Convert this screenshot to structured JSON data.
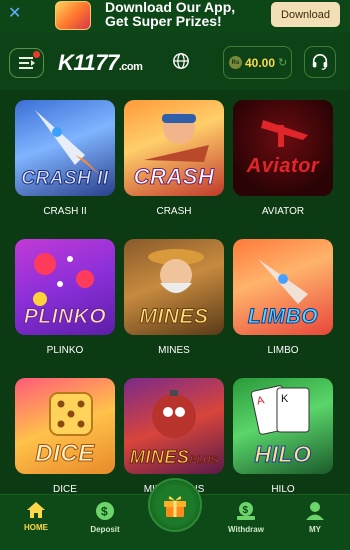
{
  "banner": {
    "line1": "Download Our App,",
    "line2": "Get Super Prizes!",
    "download_label": "Download"
  },
  "header": {
    "logo_main": "K1177",
    "logo_sub": ".com",
    "currency_badge": "Rs",
    "balance": "40.00"
  },
  "games": [
    {
      "label": "CRASH II",
      "art_title": "CRASH II"
    },
    {
      "label": "CRASH",
      "art_title": "CRASH"
    },
    {
      "label": "AVIATOR",
      "art_title": "Aviator"
    },
    {
      "label": "PLINKO",
      "art_title": "PLINKO"
    },
    {
      "label": "MINES",
      "art_title": "MINES"
    },
    {
      "label": "LIMBO",
      "art_title": "LIMBO"
    },
    {
      "label": "DICE",
      "art_title": "DICE"
    },
    {
      "label": "MINES PLUS",
      "art_title": "MINES"
    },
    {
      "label": "HILO",
      "art_title": "HILO"
    }
  ],
  "mines_plus_suffix": "PLUS",
  "nav": {
    "home": "HOME",
    "deposit": "Deposit",
    "withdraw": "Withdraw",
    "my": "MY"
  },
  "colors": {
    "background": "#0c3a12",
    "accent": "#ffd84a",
    "download_button": "#f2dfb5"
  }
}
